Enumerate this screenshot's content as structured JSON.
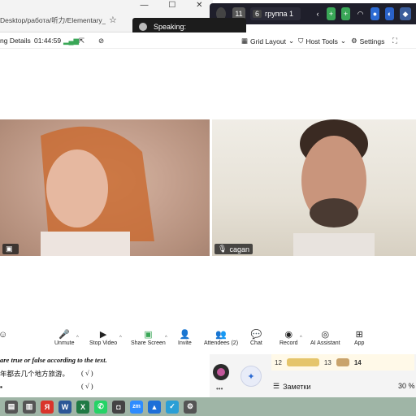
{
  "browser": {
    "url": "Desktop/работа/听力/Elementary_List",
    "minimize": "—",
    "restore": "☐",
    "close": "✕"
  },
  "system_strip": {
    "chip_11": "11",
    "chip_6": "6",
    "group_label": "группа 1"
  },
  "speaking": {
    "label": "Speaking:"
  },
  "meeting_header": {
    "details_label": "ng Details",
    "timer": "01:44:59",
    "grid_layout": "Grid Layout",
    "host_tools": "Host Tools",
    "settings": "Settings"
  },
  "participants": [
    {
      "name": ""
    },
    {
      "name": "cagan"
    }
  ],
  "toolbar": {
    "unmute": "Unmute",
    "stop_video": "Stop Video",
    "share_screen": "Share Screen",
    "invite": "Invite",
    "attendees": "Attendees (2)",
    "chat": "Chat",
    "record": "Record",
    "ai_assistant": "AI Assistant",
    "app": "App"
  },
  "document": {
    "instruction": "are true or false according to the text.",
    "line1": "年都去几个地方旅游。",
    "line1_mark": "(  √  )",
    "line2_mark": "(  √  )",
    "line0_mark": "(     )"
  },
  "notes": {
    "count_12": "12",
    "count_13": "13",
    "count_14": "14",
    "title": "Заметки",
    "zoom": "30 %"
  },
  "colors": {
    "speaking_bg": "#1c1c1c",
    "record_red": "#d9342b",
    "chat_blue": "#2d8cff",
    "taskbar": "#9fb5a6"
  }
}
